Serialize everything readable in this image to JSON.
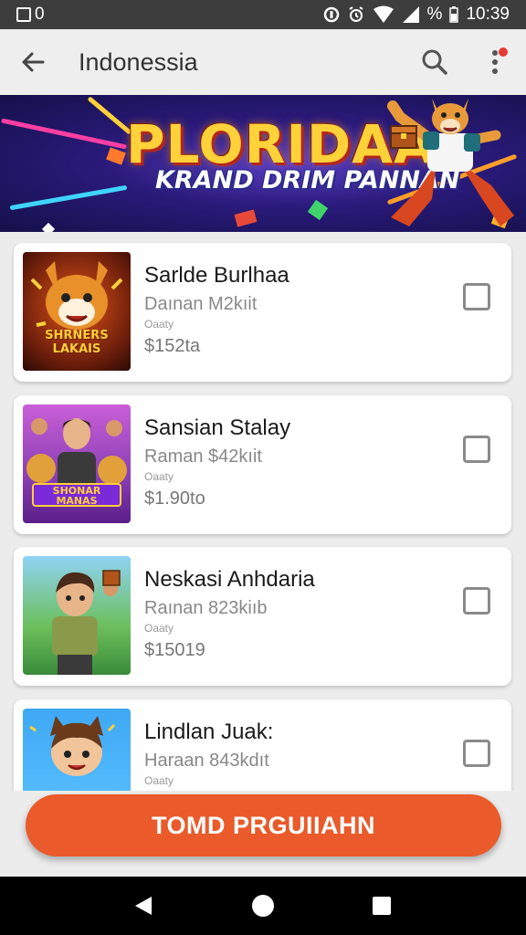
{
  "status_bar": {
    "left_text": "0",
    "right_text": "10:39",
    "percent_icon": "%",
    "icons": [
      "sim-card-icon",
      "data-saver-icon",
      "alarm-icon",
      "wifi-icon",
      "signal-icon"
    ]
  },
  "app_bar": {
    "title": "Indonessia",
    "back_icon": "arrow-left-icon",
    "search_icon": "search-icon",
    "more_icon": "more-vert-icon"
  },
  "banner": {
    "title": "PLORIDAA",
    "subtitle": "KRAND DRIM PANNAN"
  },
  "items": [
    {
      "name": "Sarlde Burlhaa",
      "subtitle": "Daınan M2kıit",
      "tag": "Oaaty",
      "price": "$152ta"
    },
    {
      "name": "Sansian Stalay",
      "subtitle": "Raman $42kıit",
      "tag": "Oaaty",
      "price": "$1.90to"
    },
    {
      "name": "Neskasi Anhdaria",
      "subtitle": "Raınan 823kiıb",
      "tag": "Oaaty",
      "price": "$15019"
    },
    {
      "name": "Lindlan Juak:",
      "subtitle": "Haraan 843kdıt",
      "tag": "Oaaty",
      "price": ""
    }
  ],
  "thumb_captions": [
    "SHRNERS LAKAIS",
    "SHONAR MANAS"
  ],
  "cta": {
    "label": "TOMD PRGUIIAHN"
  },
  "colors": {
    "cta": "#ea5a2a",
    "banner_title": "#ffd23a",
    "status_bar": "#3d3d3d"
  }
}
